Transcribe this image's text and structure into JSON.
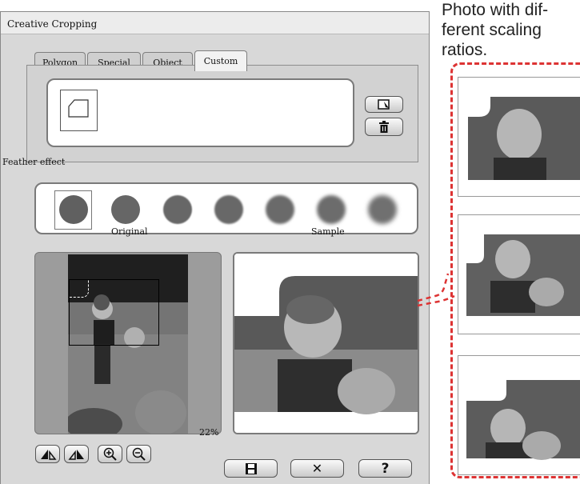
{
  "window": {
    "title": "Creative Cropping"
  },
  "tabs": [
    {
      "label": "Polygon",
      "active": false
    },
    {
      "label": "Special",
      "active": false
    },
    {
      "label": "Object",
      "active": false
    },
    {
      "label": "Custom",
      "active": true
    }
  ],
  "custom_panel": {
    "buttons": [
      {
        "name": "add-shape-button",
        "icon": "add-shape-icon"
      },
      {
        "name": "delete-button",
        "icon": "trash-icon"
      }
    ]
  },
  "feather": {
    "label": "Feather effect",
    "levels": 7,
    "selected_index": 0
  },
  "preview": {
    "original_label": "Original",
    "sample_label": "Sample",
    "zoom": "22%"
  },
  "toolbar": {
    "tools": [
      {
        "name": "rotate-left-button",
        "icon": "rotate-left-icon"
      },
      {
        "name": "rotate-right-button",
        "icon": "rotate-right-icon"
      },
      {
        "name": "zoom-in-button",
        "icon": "zoom-in-icon"
      },
      {
        "name": "zoom-out-button",
        "icon": "zoom-out-icon"
      }
    ]
  },
  "footer": {
    "save_icon": "save-icon",
    "cancel_label": "✕",
    "help_label": "?"
  },
  "annotation": {
    "text": "Photo with dif-ferent scaling ratios."
  },
  "colors": {
    "accent_dash": "#dd3333",
    "window_bg": "#d8d8d8"
  }
}
